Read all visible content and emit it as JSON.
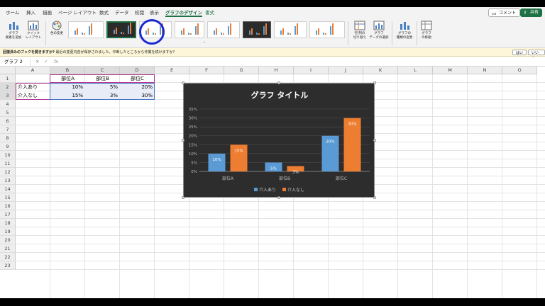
{
  "tabs": [
    {
      "label": "ホーム",
      "active": false
    },
    {
      "label": "挿入",
      "active": false
    },
    {
      "label": "描画",
      "active": false
    },
    {
      "label": "ページ レイアウト",
      "active": false
    },
    {
      "label": "数式",
      "active": false
    },
    {
      "label": "データ",
      "active": false
    },
    {
      "label": "校閲",
      "active": false
    },
    {
      "label": "表示",
      "active": false
    },
    {
      "label": "グラフのデザイン",
      "active": true
    },
    {
      "label": "書式",
      "active": false
    }
  ],
  "comment_label": "コメント",
  "share_label": "共有",
  "ribbon": {
    "add_element": "グラフ\n要素を追加",
    "quick_layout": "クイック\nレイアウト",
    "change_colors": "色の変更",
    "switch_row_col": "行/列の\n切り替え",
    "select_data": "グラフ\nデータの選択",
    "change_type": "グラフの\n種類の変更",
    "move_chart": "グラフ\nの移動"
  },
  "infobar": {
    "bold": "回復済みのブックを開きますか?",
    "text": "最近の変更内容が保存されました。中断したところから作業を続けますか?",
    "yes": "はい",
    "no": "いいえ"
  },
  "name_box": "グラフ 2",
  "fx_label": "fx",
  "columns": [
    "A",
    "B",
    "C",
    "D",
    "E",
    "F",
    "G",
    "H",
    "I",
    "J",
    "K",
    "L",
    "M",
    "N",
    "O"
  ],
  "rows": [
    "1",
    "2",
    "3",
    "4",
    "5",
    "6",
    "7",
    "8",
    "9",
    "10",
    "11",
    "12",
    "13",
    "14",
    "15",
    "16",
    "17",
    "18",
    "19",
    "20",
    "21",
    "22",
    "23"
  ],
  "table": {
    "headers": [
      "部位A",
      "部位B",
      "部位C"
    ],
    "rows": [
      {
        "label": "介入あり",
        "values": [
          "10%",
          "5%",
          "20%"
        ]
      },
      {
        "label": "介入なし",
        "values": [
          "15%",
          "3%",
          "30%"
        ]
      }
    ]
  },
  "colors": {
    "accent": "#1e7145",
    "series1": "#5b9bd5",
    "series2": "#ed7d31",
    "chart_bg": "#2d2d2d",
    "annotation_circle": "#1c2bd0"
  },
  "chart_data": {
    "type": "bar",
    "title": "グラフ タイトル",
    "categories": [
      "部位A",
      "部位B",
      "部位C"
    ],
    "series": [
      {
        "name": "介入あり",
        "values": [
          10,
          5,
          20
        ],
        "labels": [
          "10%",
          "5%",
          "20%"
        ]
      },
      {
        "name": "介入なし",
        "values": [
          15,
          3,
          30
        ],
        "labels": [
          "15%",
          "3%",
          "30%"
        ]
      }
    ],
    "yticks": [
      "0%",
      "5%",
      "10%",
      "15%",
      "20%",
      "25%",
      "30%",
      "35%"
    ],
    "ylim": [
      0,
      35
    ],
    "legend": "bottom",
    "grid": true
  }
}
